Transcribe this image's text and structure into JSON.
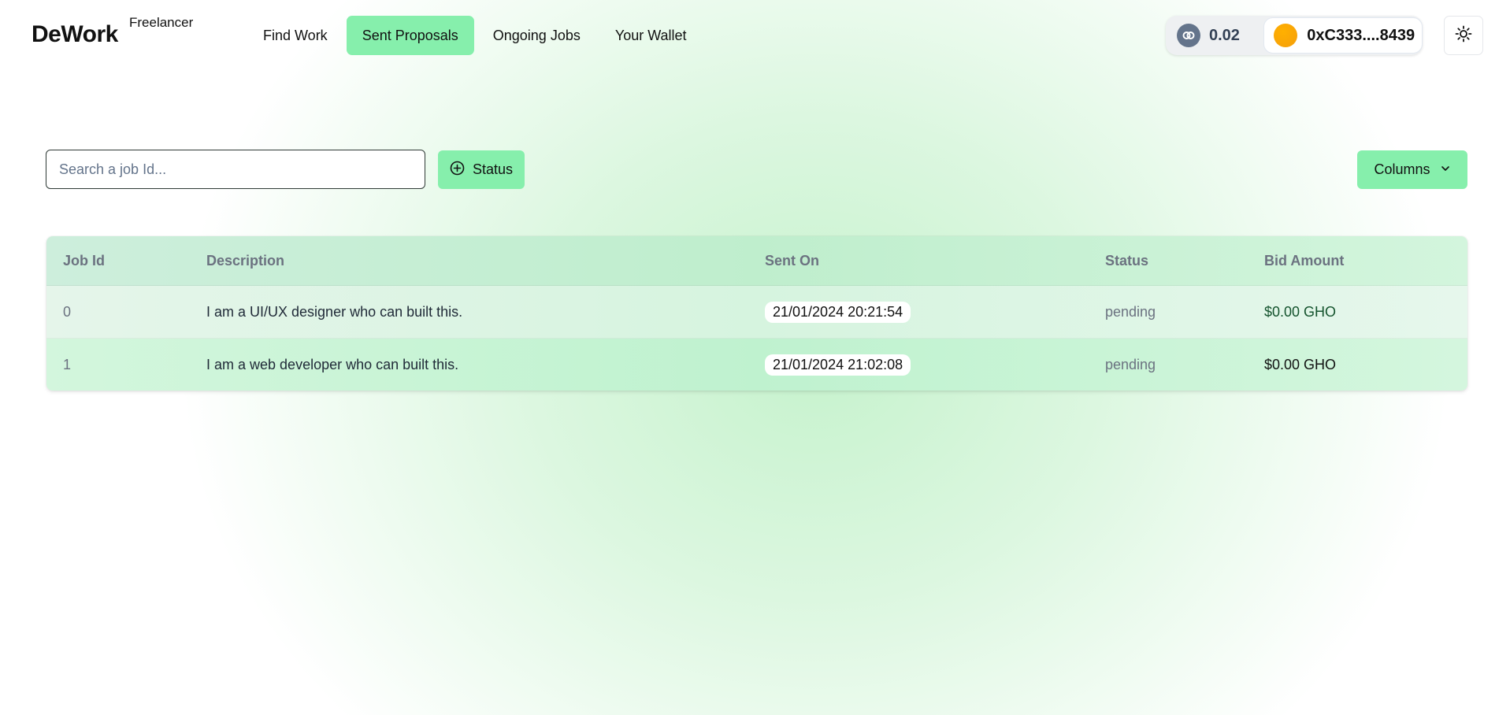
{
  "header": {
    "logo": "DeWork",
    "role": "Freelancer",
    "nav": [
      {
        "label": "Find Work",
        "active": false
      },
      {
        "label": "Sent Proposals",
        "active": true
      },
      {
        "label": "Ongoing Jobs",
        "active": false
      },
      {
        "label": "Your Wallet",
        "active": false
      }
    ],
    "wallet": {
      "balance": "0.02",
      "account": "0xC333....8439",
      "chain_icon": "chain-link-icon",
      "avatar_color": "#f59e0b"
    },
    "theme_icon": "sun-icon"
  },
  "toolbar": {
    "search_placeholder": "Search a job Id...",
    "status_label": "Status",
    "status_icon": "plus-circle-icon",
    "columns_label": "Columns",
    "columns_icon": "chevron-down-icon"
  },
  "table": {
    "headers": [
      "Job Id",
      "Description",
      "Sent On",
      "Status",
      "Bid Amount"
    ],
    "rows": [
      {
        "job_id": "0",
        "description": "I am a UI/UX designer who can built this.",
        "sent_on": "21/01/2024 20:21:54",
        "status": "pending",
        "bid": "$0.00 GHO"
      },
      {
        "job_id": "1",
        "description": "I am a web developer who can built this.",
        "sent_on": "21/01/2024 21:02:08",
        "status": "pending",
        "bid": "$0.00 GHO"
      }
    ]
  },
  "colors": {
    "accent": "#86efac",
    "background_tint": "#c6f2cd"
  }
}
